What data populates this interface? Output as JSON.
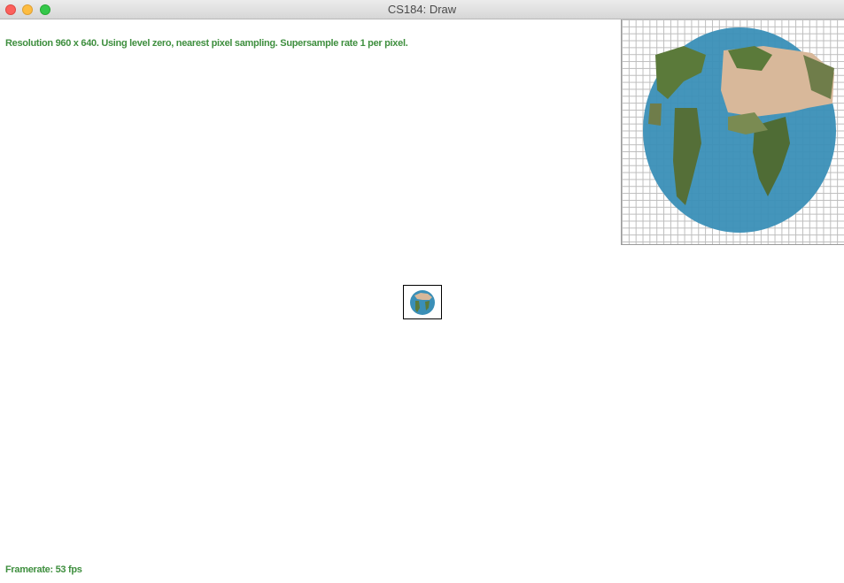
{
  "window": {
    "title": "CS184: Draw"
  },
  "status": {
    "info_text": "Resolution 960 x 640. Using level zero, nearest pixel sampling. Supersample rate 1 per pixel.",
    "framerate_text": "Framerate: 53 fps"
  },
  "colors": {
    "status_text": "#3f8f3f",
    "ocean": "#3a8fb7",
    "land_green": "#5b7a3a",
    "land_tan": "#d8b89a"
  },
  "icons": {
    "close": "window-close-icon",
    "minimize": "window-minimize-icon",
    "maximize": "window-maximize-icon"
  }
}
